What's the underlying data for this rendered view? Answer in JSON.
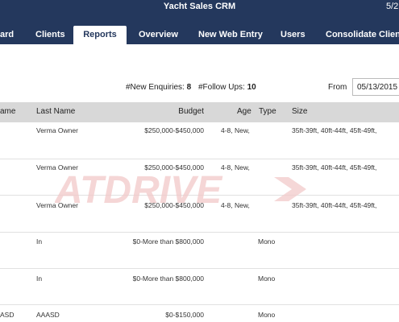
{
  "app": {
    "title": "Yacht Sales CRM",
    "date_partial": "5/2"
  },
  "nav": {
    "tabs": [
      {
        "label": "ard"
      },
      {
        "label": "Clients"
      },
      {
        "label": "Reports"
      },
      {
        "label": "Overview"
      },
      {
        "label": "New Web Entry"
      },
      {
        "label": "Users"
      },
      {
        "label": "Consolidate Clients"
      }
    ],
    "active": "Reports"
  },
  "stats": {
    "new_enquiries_label": "#New Enquiries:",
    "new_enquiries_value": "8",
    "follow_ups_label": "#Follow Ups:",
    "follow_ups_value": "10"
  },
  "filter": {
    "from_label": "From",
    "from_value": "05/13/2015"
  },
  "table": {
    "headers": {
      "first_name": "ame",
      "last_name": "Last Name",
      "budget": "Budget",
      "age": "Age",
      "type": "Type",
      "size": "Size"
    },
    "rows": [
      {
        "first": "",
        "last": "Verma Owner",
        "budget": "$250,000-$450,000",
        "age": "4-8, New,",
        "type": "",
        "size": "35ft-39ft, 40ft-44ft, 45ft-49ft,"
      },
      {
        "first": "",
        "last": "Verma Owner",
        "budget": "$250,000-$450,000",
        "age": "4-8, New,",
        "type": "",
        "size": "35ft-39ft, 40ft-44ft, 45ft-49ft,"
      },
      {
        "first": "",
        "last": "Verma Owner",
        "budget": "$250,000-$450,000",
        "age": "4-8, New,",
        "type": "",
        "size": "35ft-39ft, 40ft-44ft, 45ft-49ft,"
      },
      {
        "first": "",
        "last": "In",
        "budget": "$0-More than $800,000",
        "age": "",
        "type": "Mono",
        "size": ""
      },
      {
        "first": "",
        "last": "In",
        "budget": "$0-More than $800,000",
        "age": "",
        "type": "Mono",
        "size": ""
      },
      {
        "first": "ASD",
        "last": "AAASD",
        "budget": "$0-$150,000",
        "age": "",
        "type": "Mono",
        "size": ""
      }
    ]
  },
  "watermark": {
    "text": "ATDRIVE",
    "color": "#f2c9c9"
  },
  "colors": {
    "nav_bg": "#24385d",
    "header_bg": "#d8d8d8",
    "row_border": "#e1e1e1"
  }
}
